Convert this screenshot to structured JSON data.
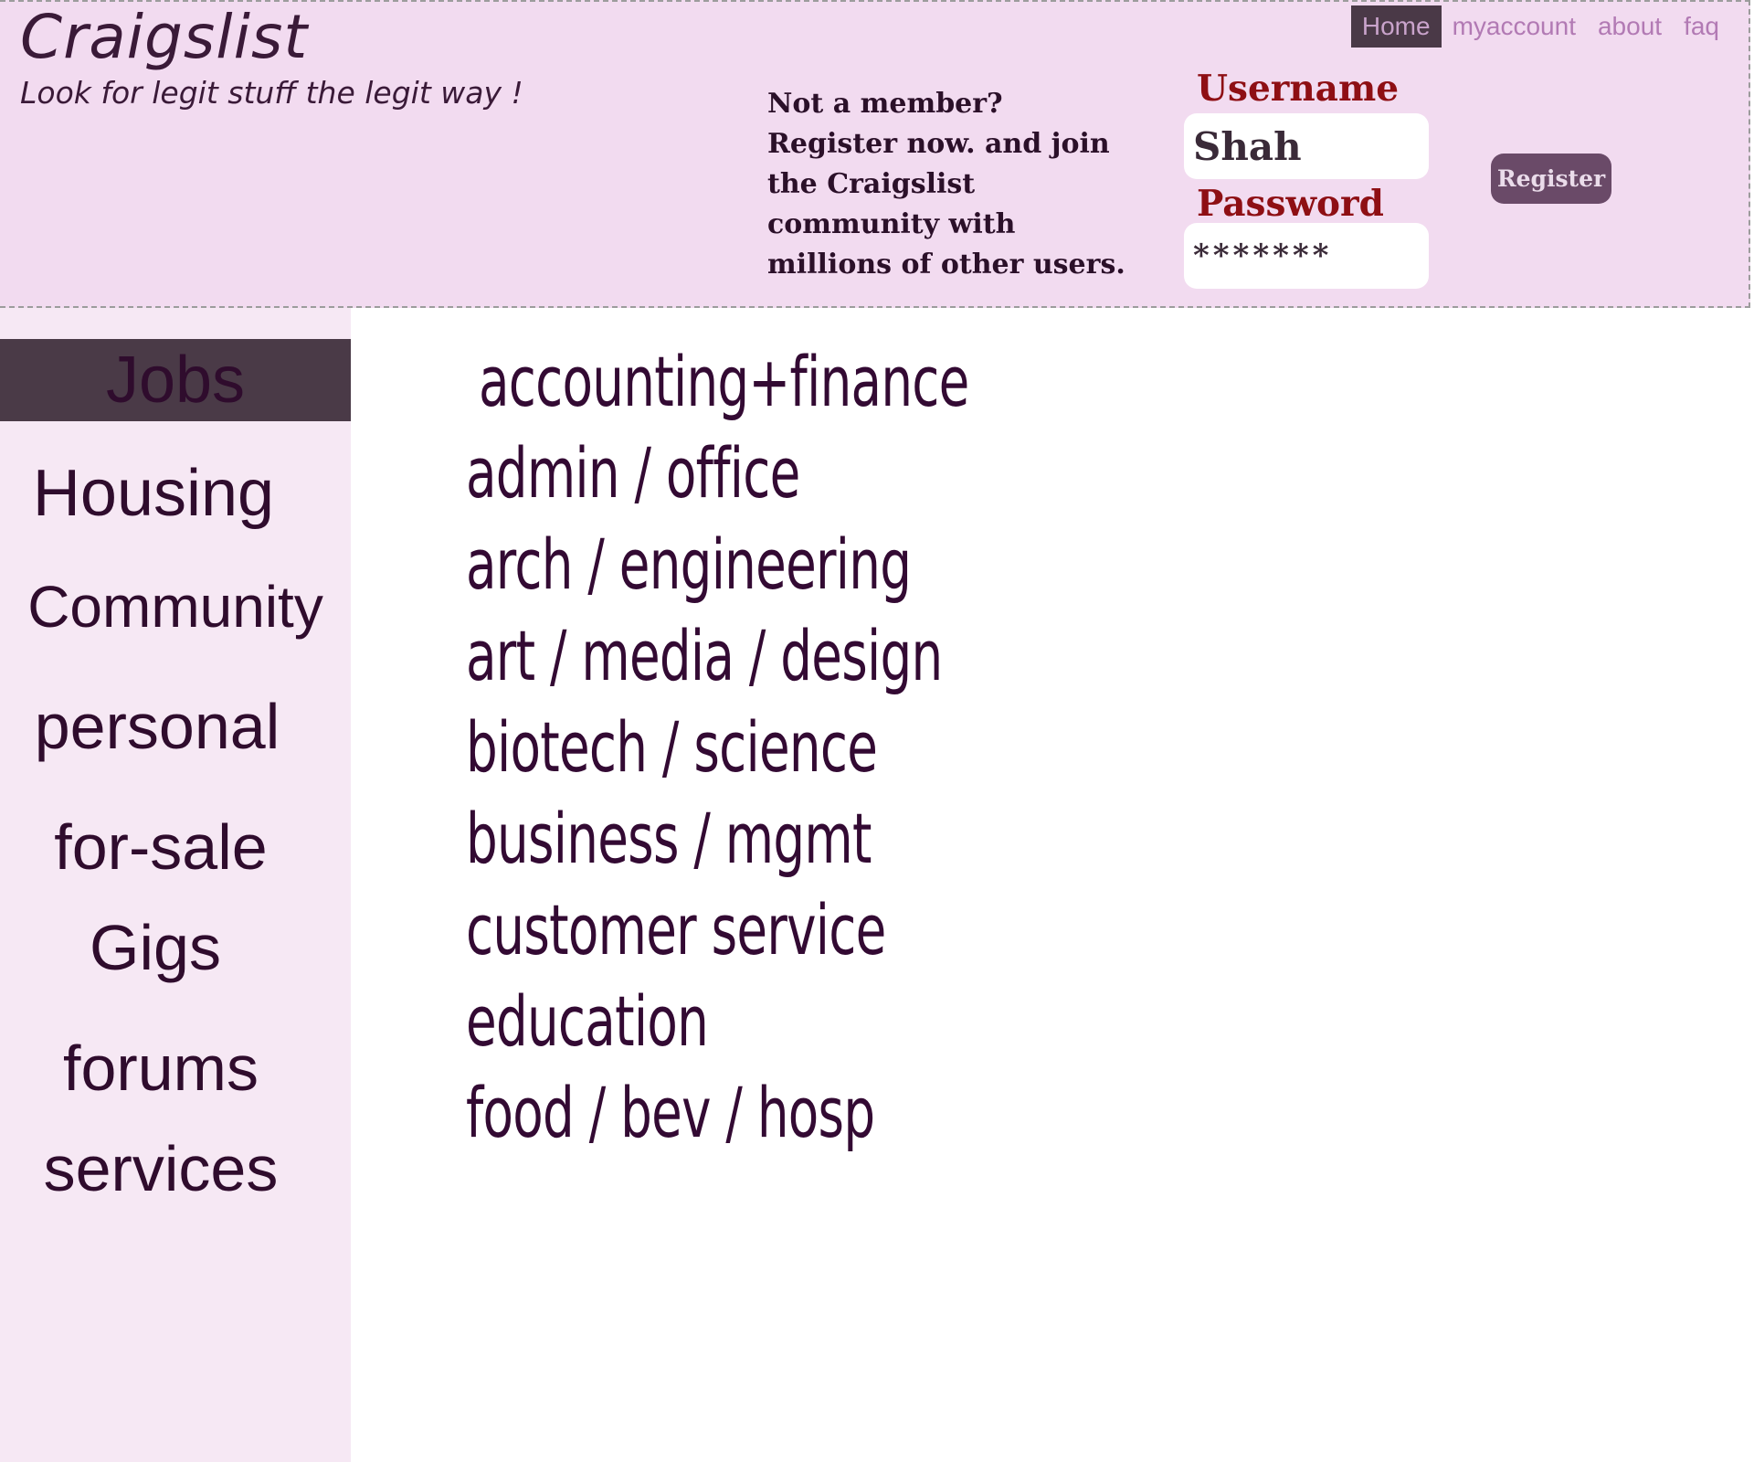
{
  "brand": {
    "name": "Craigslist",
    "tagline": "Look for legit stuff the legit way !"
  },
  "topnav": {
    "items": [
      "Home",
      "myaccount",
      "about",
      "faq"
    ],
    "active": "Home"
  },
  "register_promo": "Not a member? Register now. and join the Craigslist community with millions of other users.",
  "login": {
    "username_label": "Username",
    "username_value": "Shah",
    "password_label": "Password",
    "password_value": "*******",
    "register_button": "Register"
  },
  "sidebar": {
    "items": [
      "Jobs",
      "Housing",
      "Community",
      "personal",
      "for-sale",
      "Gigs",
      "forums",
      "services"
    ],
    "active": "Jobs"
  },
  "categories": [
    "accounting+finance",
    "admin / office",
    "arch / engineering",
    "art / media / design",
    "biotech / science",
    "business / mgmt",
    "customer service",
    "education",
    "food / bev / hosp"
  ],
  "colors": {
    "header_bg": "#f2dbf0",
    "sidebar_bg": "#f6e8f4",
    "active_bg": "#4a3a47",
    "text_dark": "#2f0c2d",
    "label_red": "#8e0f14",
    "nav_link": "#b27ab4"
  }
}
